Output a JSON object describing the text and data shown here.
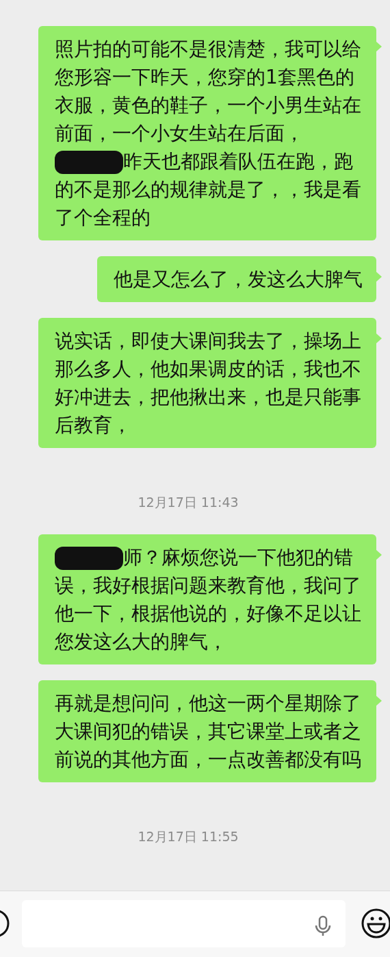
{
  "messages": [
    {
      "kind": "message",
      "parts": [
        {
          "kind": "text",
          "text": "照片拍的可能不是很清楚，我可以给您形容一下昨天，您穿的1套黑色的衣服，黄色的鞋子，一个小男生站在前面，一个小女生站在后面，"
        },
        {
          "kind": "redaction"
        },
        {
          "kind": "text",
          "text": "昨天也都跟着队伍在跑，跑的不是那么的规律就是了，，我是看了个全程的"
        }
      ]
    },
    {
      "kind": "message",
      "parts": [
        {
          "kind": "text",
          "text": "他是又怎么了，发这么大脾气"
        }
      ]
    },
    {
      "kind": "message",
      "parts": [
        {
          "kind": "text",
          "text": "说实话，即使大课间我去了，操场上那么多人，他如果调皮的话，我也不好冲进去，把他揪出来，也是只能事后教育，"
        }
      ]
    },
    {
      "kind": "time",
      "text": "12月17日 11:43"
    },
    {
      "kind": "message",
      "parts": [
        {
          "kind": "redaction"
        },
        {
          "kind": "text",
          "text": "师？麻烦您说一下他犯的错误，我好根据问题来教育他，我问了他一下，根据他说的，好像不足以让您发这么大的脾气，"
        }
      ]
    },
    {
      "kind": "message",
      "parts": [
        {
          "kind": "text",
          "text": "再就是想问问，他这一两个星期除了大课间犯的错误，其它课堂上或者之前说的其他方面，一点改善都没有吗"
        }
      ]
    },
    {
      "kind": "time",
      "text": "12月17日 11:55"
    }
  ]
}
